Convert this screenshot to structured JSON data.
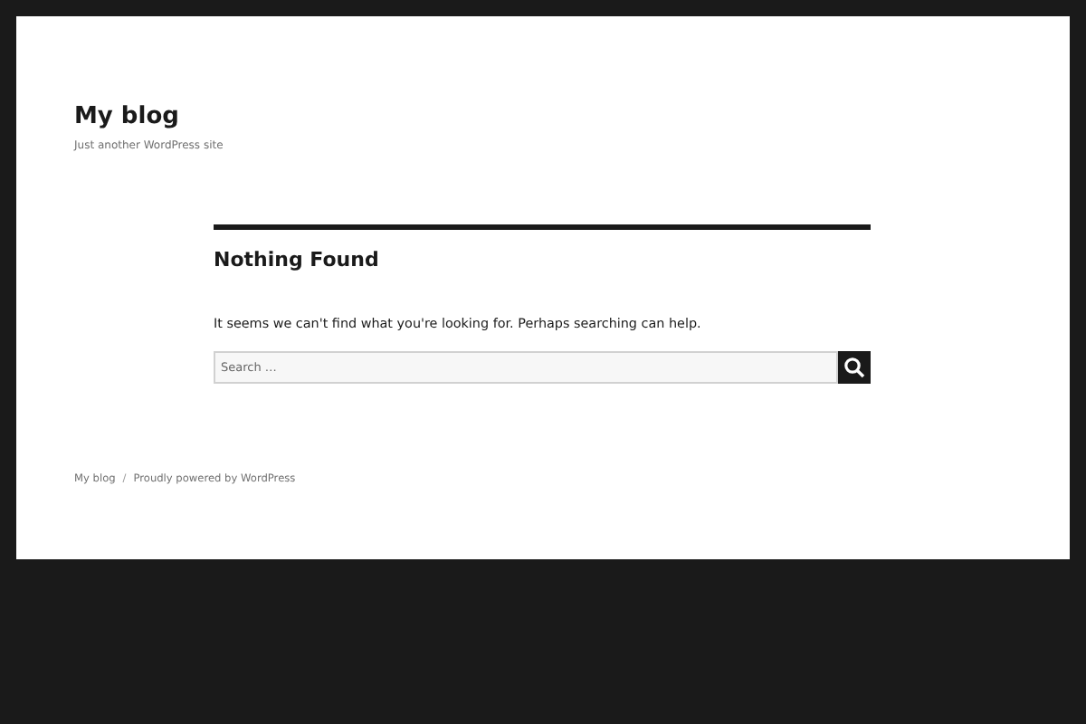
{
  "site": {
    "title": "My blog",
    "tagline": "Just another WordPress site"
  },
  "main": {
    "heading": "Nothing Found",
    "message": "It seems we can't find what you're looking for. Perhaps searching can help.",
    "search": {
      "placeholder": "Search …"
    }
  },
  "footer": {
    "site_link": "My blog",
    "separator": "/",
    "credit": "Proudly powered by WordPress"
  }
}
